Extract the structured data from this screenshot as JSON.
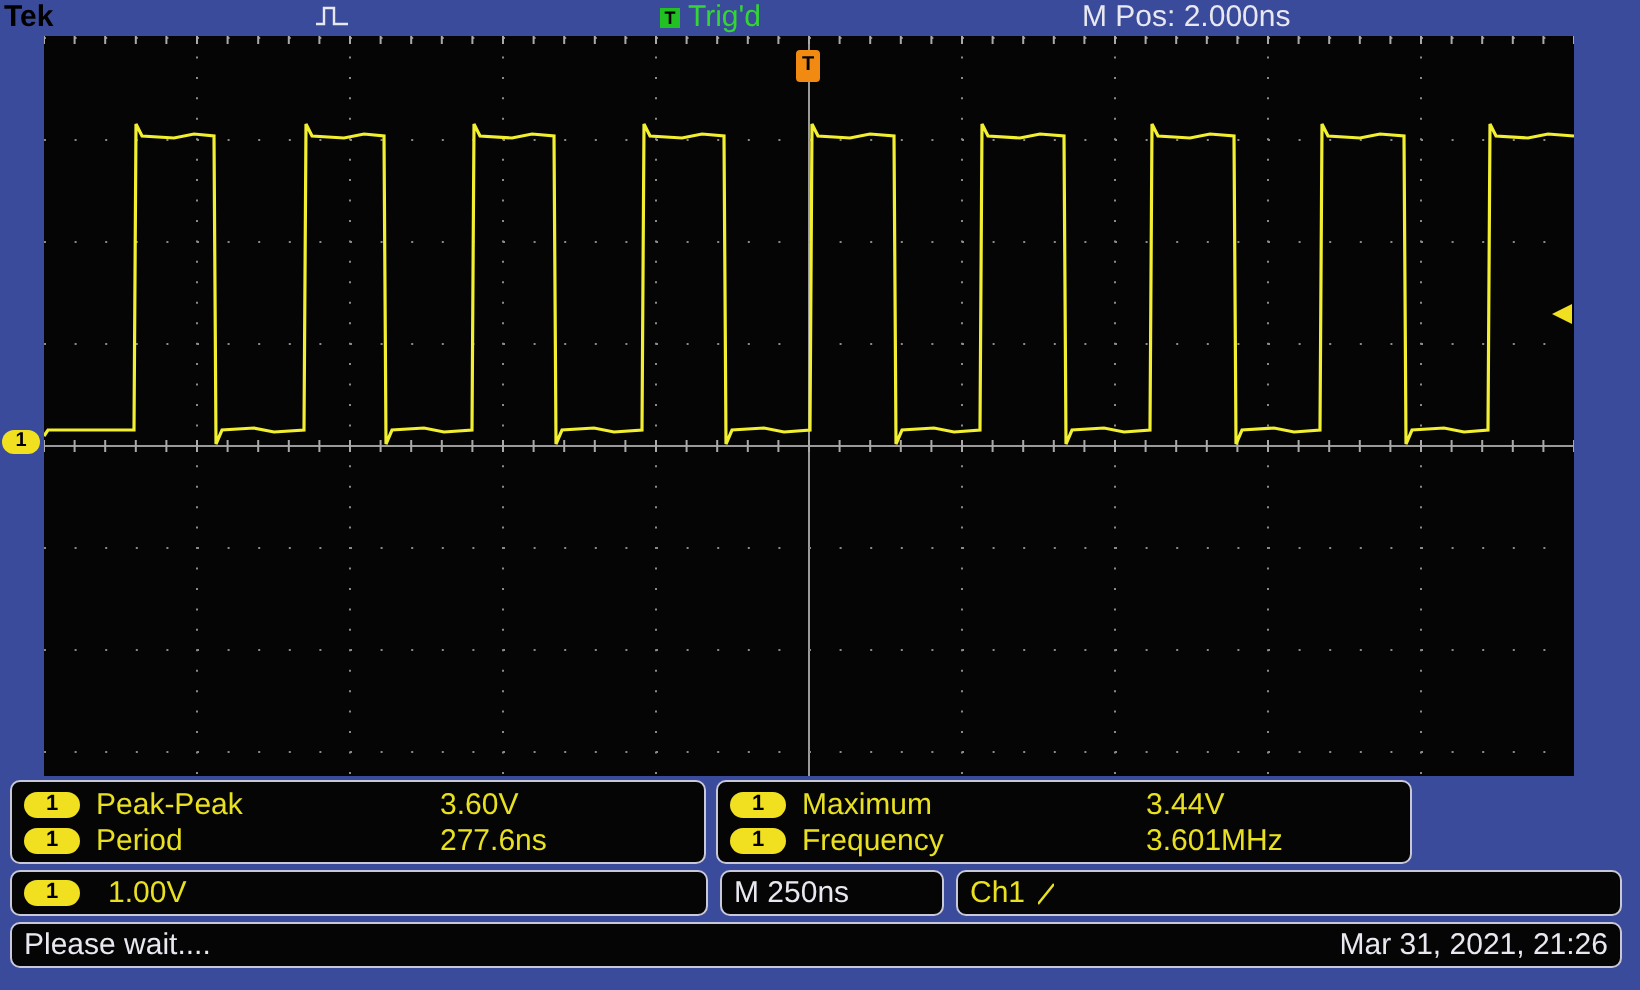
{
  "header": {
    "brand": "Tek",
    "trigger_badge": "T",
    "trigger_status": "Trig'd",
    "position": "M Pos: 2.000ns"
  },
  "graticule": {
    "trigger_marker": "T",
    "channel_marker": "1"
  },
  "measurement_panels": [
    {
      "rows": [
        {
          "channel": "1",
          "label": "Peak-Peak",
          "value": "3.60V"
        },
        {
          "channel": "1",
          "label": "Period",
          "value": "277.6ns"
        }
      ]
    },
    {
      "rows": [
        {
          "channel": "1",
          "label": "Maximum",
          "value": "3.44V"
        },
        {
          "channel": "1",
          "label": "Frequency",
          "value": "3.601MHz"
        }
      ]
    }
  ],
  "channel_scale": {
    "channel": "1",
    "value": "1.00V"
  },
  "timebase": "M 250ns",
  "trigger": {
    "source": "Ch1"
  },
  "status": {
    "message": "Please wait....",
    "datetime": "Mar 31, 2021, 21:26"
  }
}
